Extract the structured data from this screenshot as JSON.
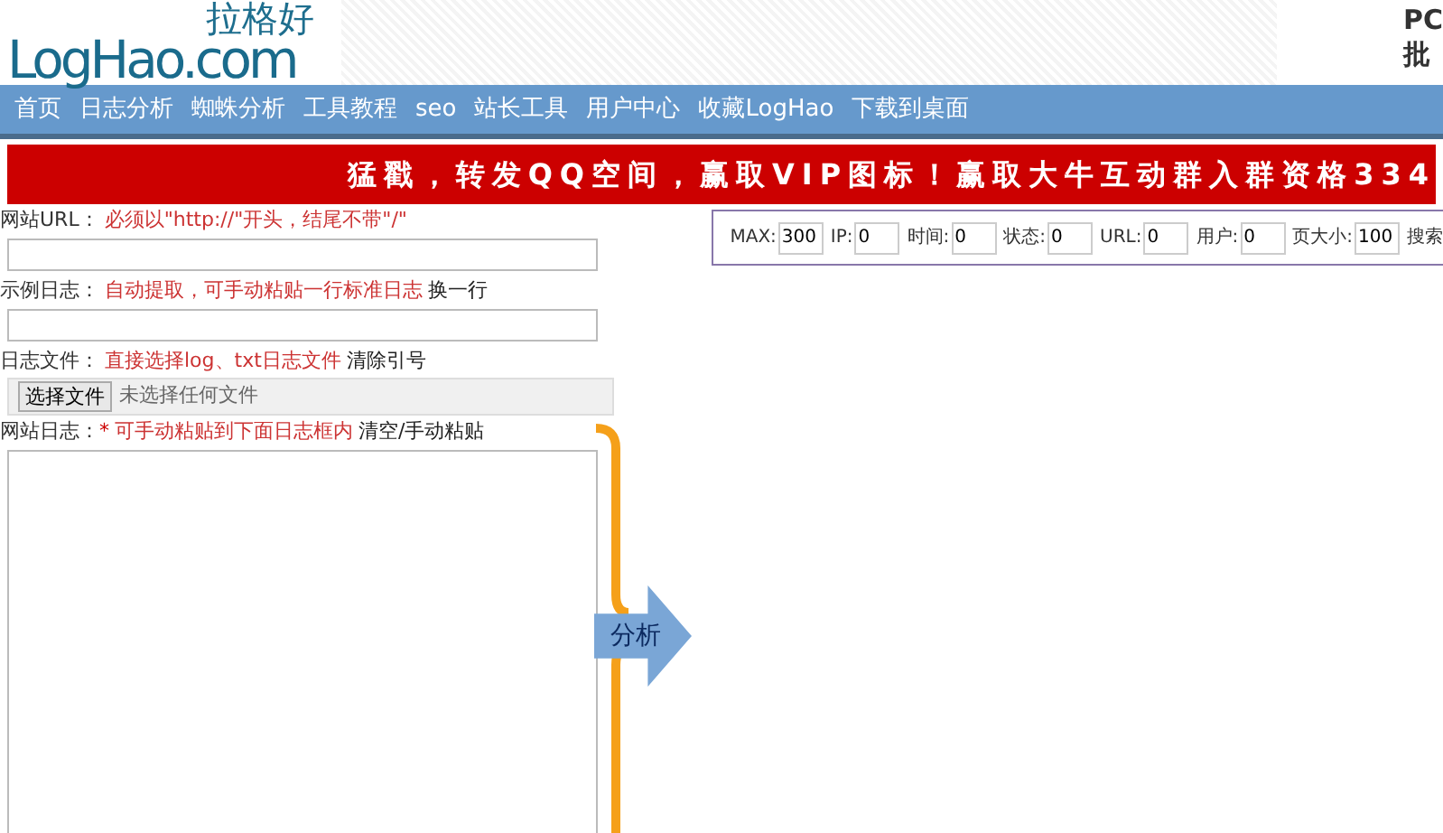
{
  "logo": {
    "tagline": "拉格好",
    "brand": "LogHao.com"
  },
  "header_side": [
    "PC",
    "批"
  ],
  "nav": [
    {
      "label": "首页"
    },
    {
      "label": "日志分析"
    },
    {
      "label": "蜘蛛分析"
    },
    {
      "label": "工具教程"
    },
    {
      "label": "seo"
    },
    {
      "label": "站长工具"
    },
    {
      "label": "用户中心"
    },
    {
      "label": "收藏LogHao"
    },
    {
      "label": "下载到桌面"
    }
  ],
  "banner": "猛戳，转发QQ空间，赢取VIP图标！赢取大牛互动群入群资格334",
  "form": [
    {
      "kind": "input",
      "label": "网站URL：",
      "hint": "必须以\"http://\"开头，结尾不带\"/\""
    },
    {
      "kind": "input",
      "label": "示例日志：",
      "hint": "自动提取，可手动粘贴一行标准日志",
      "action": "换一行"
    },
    {
      "kind": "file",
      "label": "日志文件：",
      "hint": "直接选择log、txt日志文件",
      "action": "清除引号",
      "button": "选择文件",
      "status": "未选择任何文件"
    },
    {
      "kind": "textarea",
      "label": "网站日志：",
      "required": "*",
      "hint": "可手动粘贴到下面日志框内",
      "action": "清空/手动粘贴"
    }
  ],
  "analyze_button": "分析",
  "filters": [
    {
      "label": "MAX:",
      "value": "300"
    },
    {
      "label": "IP:",
      "value": "0"
    },
    {
      "label": "时间:",
      "value": "0"
    },
    {
      "label": "状态:",
      "value": "0"
    },
    {
      "label": "URL:",
      "value": "0"
    },
    {
      "label": "用户:",
      "value": "0"
    },
    {
      "label": "页大小:",
      "value": "100"
    }
  ],
  "filter_tail": "搜索"
}
